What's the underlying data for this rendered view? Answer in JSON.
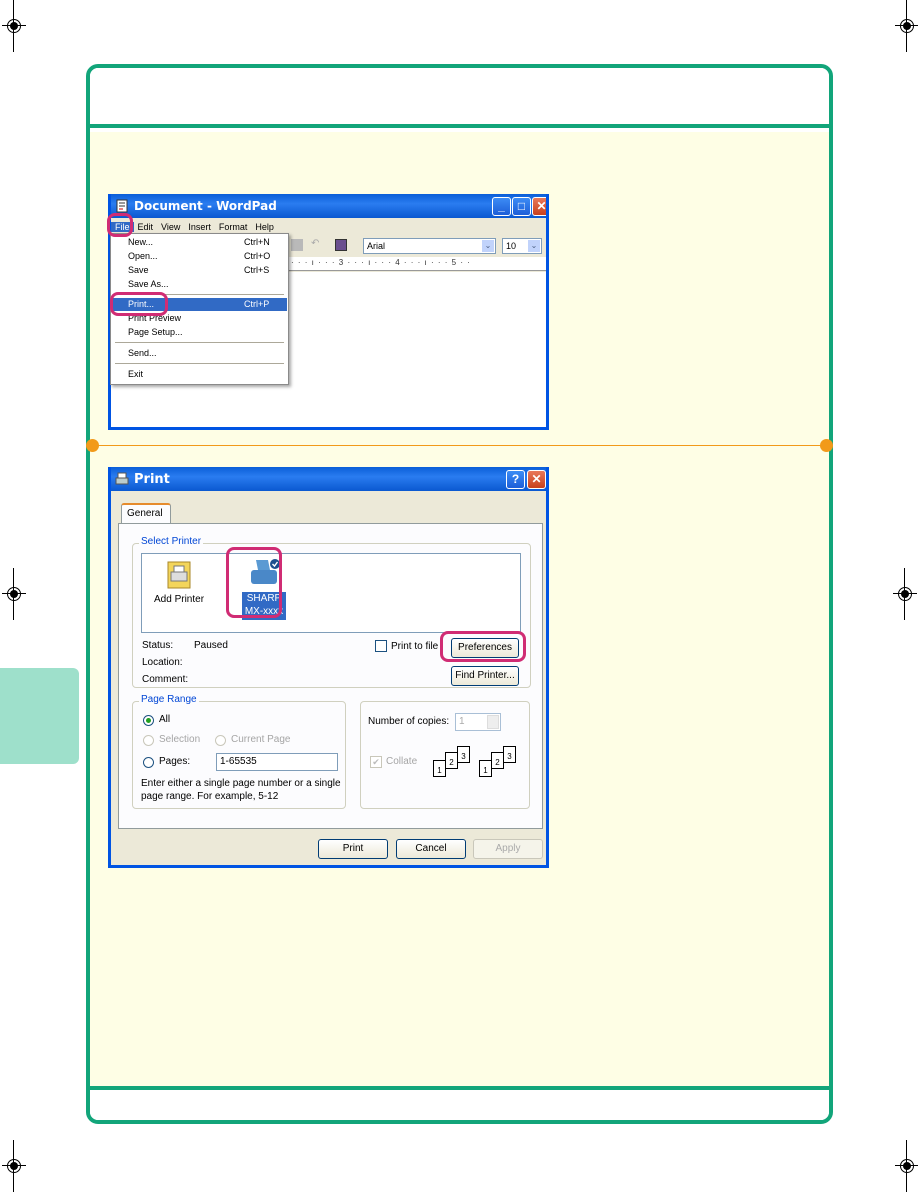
{
  "wordpad": {
    "title": "Document - WordPad",
    "menubar": [
      "File",
      "Edit",
      "View",
      "Insert",
      "Format",
      "Help"
    ],
    "font_name": "Arial",
    "font_size": "10",
    "ruler": "· · · ı · · · 3 · · · ı · · · 4 · · · ı · · · 5 · ·",
    "file_menu": [
      {
        "label": "New...",
        "shortcut": "Ctrl+N"
      },
      {
        "label": "Open...",
        "shortcut": "Ctrl+O"
      },
      {
        "label": "Save",
        "shortcut": "Ctrl+S"
      },
      {
        "label": "Save As...",
        "shortcut": ""
      },
      {
        "label": "Print...",
        "shortcut": "Ctrl+P"
      },
      {
        "label": "Print Preview",
        "shortcut": ""
      },
      {
        "label": "Page Setup...",
        "shortcut": ""
      },
      {
        "label": "Send...",
        "shortcut": ""
      },
      {
        "label": "Exit",
        "shortcut": ""
      }
    ],
    "highlighted_menu": "File",
    "highlighted_item": "Print..."
  },
  "print_dialog": {
    "title": "Print",
    "help_button": "?",
    "tab": "General",
    "select_printer": {
      "legend": "Select Printer",
      "printers": [
        {
          "name": "Add Printer"
        },
        {
          "name_line1": "SHARP",
          "name_line2": "MX-xxxx",
          "selected": true,
          "default": true
        }
      ]
    },
    "status_label": "Status:",
    "status_value": "Paused",
    "location_label": "Location:",
    "comment_label": "Comment:",
    "print_to_file": "Print to file",
    "preferences_button": "Preferences",
    "find_printer_button": "Find Printer...",
    "page_range": {
      "legend": "Page Range",
      "all": "All",
      "selection": "Selection",
      "current_page": "Current Page",
      "pages": "Pages:",
      "pages_value": "1-65535",
      "hint_line1": "Enter either a single page number or a single",
      "hint_line2": "page range.  For example, 5-12"
    },
    "copies_label": "Number of copies:",
    "copies_value": "1",
    "collate": "Collate",
    "collate_sheets": [
      "1",
      "2",
      "3"
    ],
    "buttons": {
      "print": "Print",
      "cancel": "Cancel",
      "apply": "Apply"
    }
  },
  "colors": {
    "frame_green": "#12a57a",
    "panel_cream": "#fefee5",
    "callout_magenta": "#d02c74",
    "step_orange": "#f29a1a",
    "side_tab": "#9ee0cb",
    "xp_blue": "#0054e3"
  }
}
